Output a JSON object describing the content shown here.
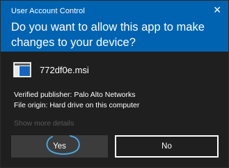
{
  "dialog": {
    "title": "User Account Control",
    "close_glyph": "✕",
    "question": "Do you want to allow this app to make changes to your device?",
    "file_name": "772df0e.msi",
    "file_icon": "msi-installer-icon",
    "publisher_line": "Verified publisher: Palo Alto Networks",
    "origin_line": "File origin: Hard drive on this computer",
    "show_more": "Show more details",
    "yes_label": "Yes",
    "no_label": "No"
  },
  "colors": {
    "header": "#0063b1",
    "body": "#1f1f1f",
    "annotation": "#4aa3df"
  }
}
